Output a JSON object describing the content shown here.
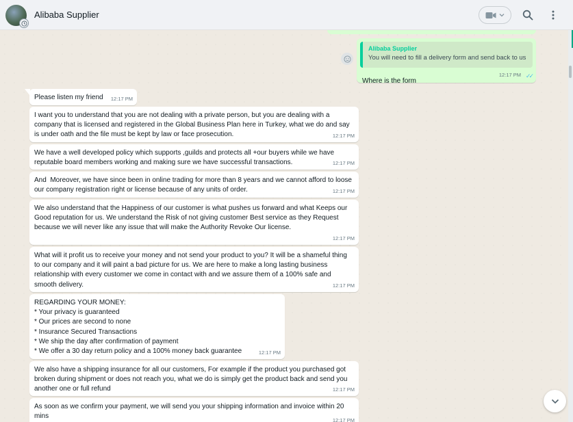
{
  "header": {
    "contact_name": "Alibaba Supplier",
    "video_label": "video-call",
    "icons": [
      "video-icon",
      "chevron-down-icon",
      "search-icon",
      "menu-icon"
    ]
  },
  "reply": {
    "quoted_author": "Alibaba Supplier",
    "quoted_text": "You will need to fill a delivery form and send back to us",
    "text": "Where is the form",
    "time": "12:17 PM"
  },
  "messages": [
    {
      "text": "Please listen my friend",
      "time": "12:17 PM"
    },
    {
      "text": "I want you to understand that you are not dealing with a private person, but you are dealing with a company that is licensed and registered in the Global Business Plan here in Turkey, what we do and say is under oath and the file must be kept by law or face prosecution.",
      "time": "12:17 PM"
    },
    {
      "text": "We have a well developed policy which supports ,guilds and protects all +our buyers while we have reputable board members working and making sure we have successful transactions.",
      "time": "12:17 PM"
    },
    {
      "text": "And  Moreover, we have since been in online trading for more than 8 years and we cannot afford to loose our company registration right or license because of any units of order.",
      "time": "12:17 PM"
    },
    {
      "text": "We also understand that the Happiness of our customer is what pushes us forward and what Keeps our Good reputation for us. We understand the Risk of not giving customer Best service as they Request because we will never like any issue that will make the Authority Revoke Our license.",
      "time": "12:17 PM"
    },
    {
      "text": "What will it profit us to receive your money and not send your product to you? It will be a shameful thing to our company and it will paint a bad picture for us. We are here to make a long lasting business relationship with every customer we come in contact with and we assure them of a 100% safe and smooth delivery.",
      "time": "12:17 PM"
    },
    {
      "text": "REGARDING YOUR MONEY:\n* Your privacy is guaranteed\n* Our prices are second to none\n* Insurance Secured Transactions\n* We ship the day after confirmation of payment\n* We offer a 30 day return policy and a 100% money back guarantee",
      "time": "12:17 PM"
    },
    {
      "text": "We also have a shipping insurance for all our customers, For example if the product you purchased got broken during shipment or does not reach you, what we do is simply get the product back and send you another one or full refund",
      "time": "12:17 PM"
    },
    {
      "text": "As soon as we confirm your payment, we will send you your shipping information and invoice within 20 mins",
      "time": "12:17 PM"
    }
  ]
}
